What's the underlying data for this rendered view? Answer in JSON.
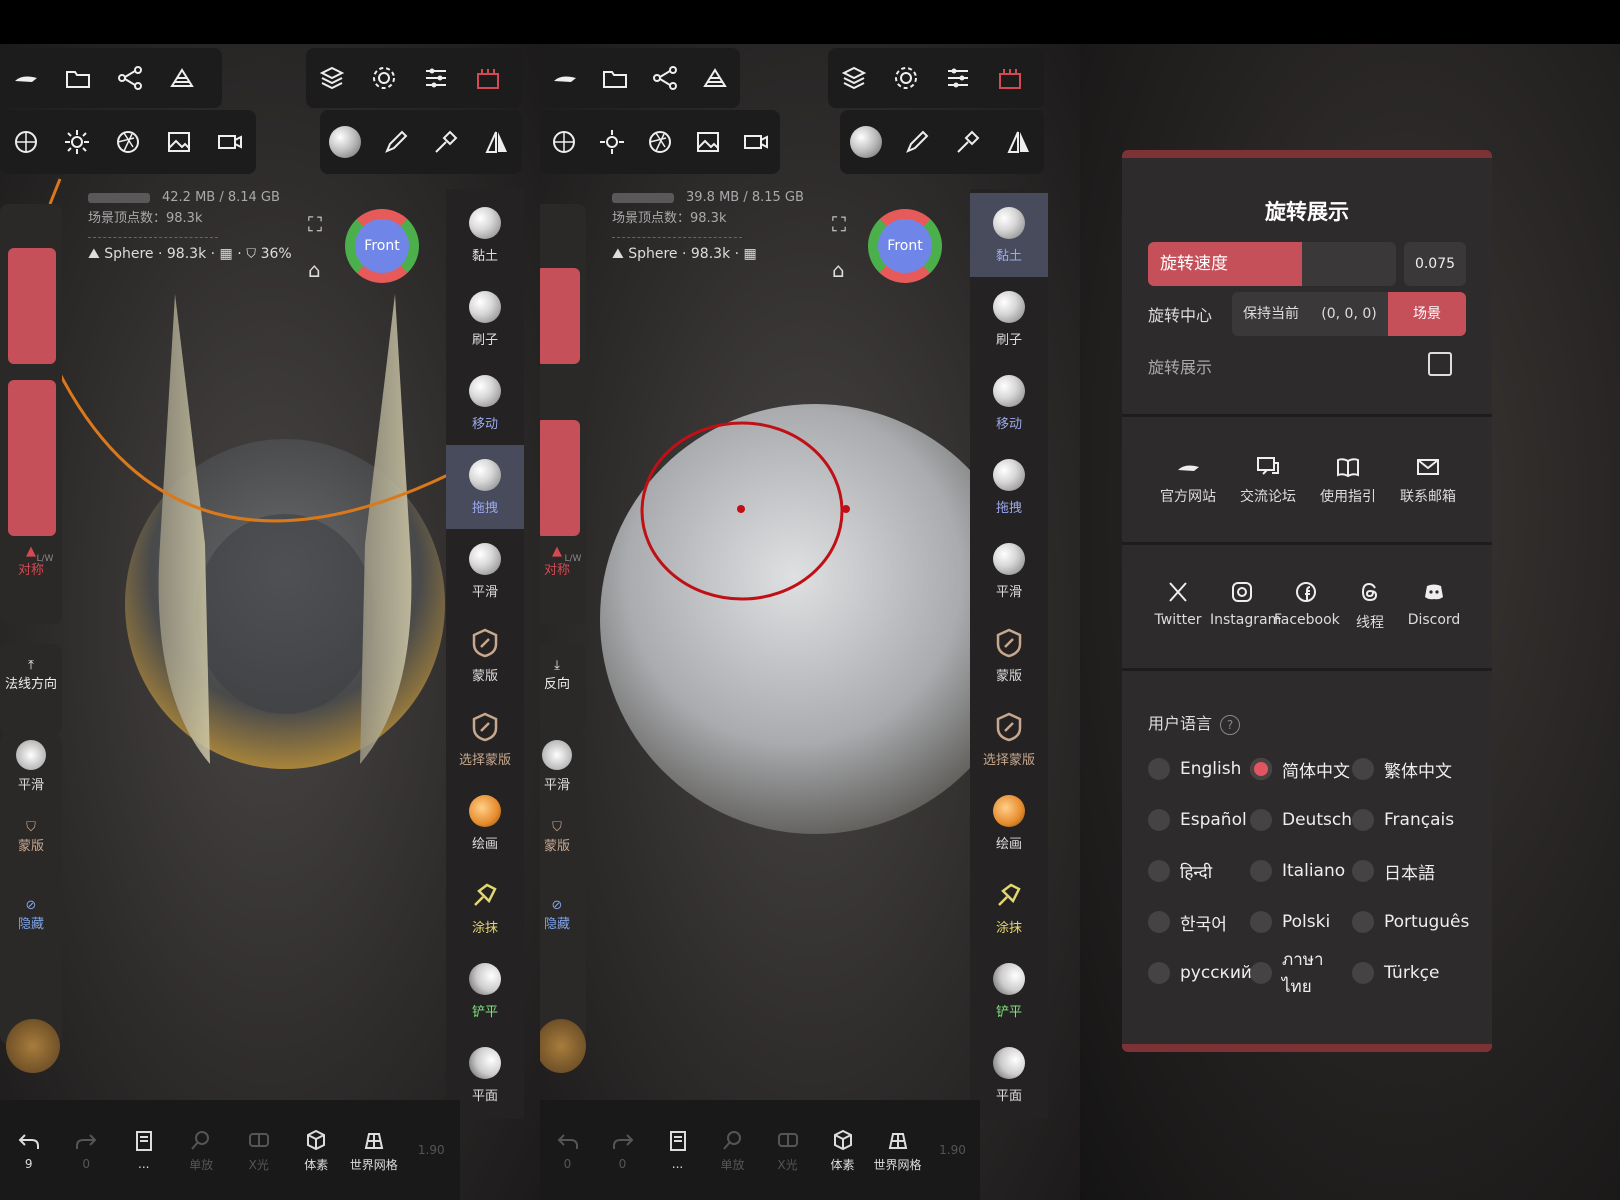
{
  "colors": {
    "accent": "#c5505a",
    "panel": "#2d2b2b",
    "toolbar": "#1d1c1c",
    "selected_tool": "#474b5c"
  },
  "left": {
    "memory": "42.2 MB / 8.14 GB",
    "vertices": "场景顶点数：98.3k",
    "object": "Sphere · 98.3k · ▦ · ⛉ 36%",
    "gizmo_label": "Front",
    "sym_label": "对称",
    "lw_label": "L/W",
    "normal_label": "法线方向",
    "smooth_label": "平滑",
    "mask_label": "蒙版",
    "hide_label": "隐藏",
    "tools": [
      "黏土",
      "刷子",
      "移动",
      "拖拽",
      "平滑",
      "蒙版",
      "选择蒙版",
      "绘画",
      "涂抹",
      "铲平",
      "平面"
    ],
    "selected_tool": "拖拽",
    "bottom": [
      {
        "label": "9",
        "icon": "undo-icon"
      },
      {
        "label": "0",
        "icon": "redo-icon"
      },
      {
        "label": "...",
        "icon": "book-icon"
      },
      {
        "label": "单放",
        "icon": "search-icon"
      },
      {
        "label": "X光",
        "icon": "xray-icon"
      },
      {
        "label": "体素",
        "icon": "voxel-icon"
      },
      {
        "label": "世界网格",
        "icon": "grid-icon"
      },
      {
        "label": "1.90",
        "icon": ""
      }
    ]
  },
  "mid": {
    "memory": "39.8 MB / 8.15 GB",
    "vertices": "场景顶点数：98.3k",
    "object": "Sphere · 98.3k · ▦",
    "gizmo_label": "Front",
    "sym_label": "对称",
    "lw_label": "L/W",
    "normal_label": "反向",
    "smooth_label": "平滑",
    "mask_label": "蒙版",
    "hide_label": "隐藏",
    "tools": [
      "黏土",
      "刷子",
      "移动",
      "拖拽",
      "平滑",
      "蒙版",
      "选择蒙版",
      "绘画",
      "涂抹",
      "铲平",
      "平面"
    ],
    "selected_tool": "黏土",
    "bottom": [
      {
        "label": "0",
        "icon": "undo-icon"
      },
      {
        "label": "0",
        "icon": "redo-icon"
      },
      {
        "label": "...",
        "icon": "book-icon"
      },
      {
        "label": "单放",
        "icon": "search-icon"
      },
      {
        "label": "X光",
        "icon": "xray-icon"
      },
      {
        "label": "体素",
        "icon": "voxel-icon"
      },
      {
        "label": "世界网格",
        "icon": "grid-icon"
      },
      {
        "label": "1.90",
        "icon": ""
      }
    ]
  },
  "settings": {
    "title": "旋转展示",
    "speed_label": "旋转速度",
    "speed_fraction": 0.62,
    "speed_value": "0.075",
    "center_label": "旋转中心",
    "center_options": [
      "保持当前",
      "(0, 0, 0)",
      "场景"
    ],
    "center_selected": "场景",
    "showcase_label": "旋转展示",
    "links": [
      "官方网站",
      "交流论坛",
      "使用指引",
      "联系邮箱"
    ],
    "social": [
      "Twitter",
      "Instagram",
      "Facebook",
      "线程",
      "Discord"
    ],
    "language_title": "用户语言",
    "help_icon": "?",
    "languages": [
      "English",
      "简体中文",
      "繁体中文",
      "Español",
      "Deutsch",
      "Français",
      "हिन्दी",
      "Italiano",
      "日本語",
      "한국어",
      "Polski",
      "Português",
      "русский",
      "ภาษาไทย",
      "Türkçe"
    ],
    "selected_language": "简体中文"
  }
}
